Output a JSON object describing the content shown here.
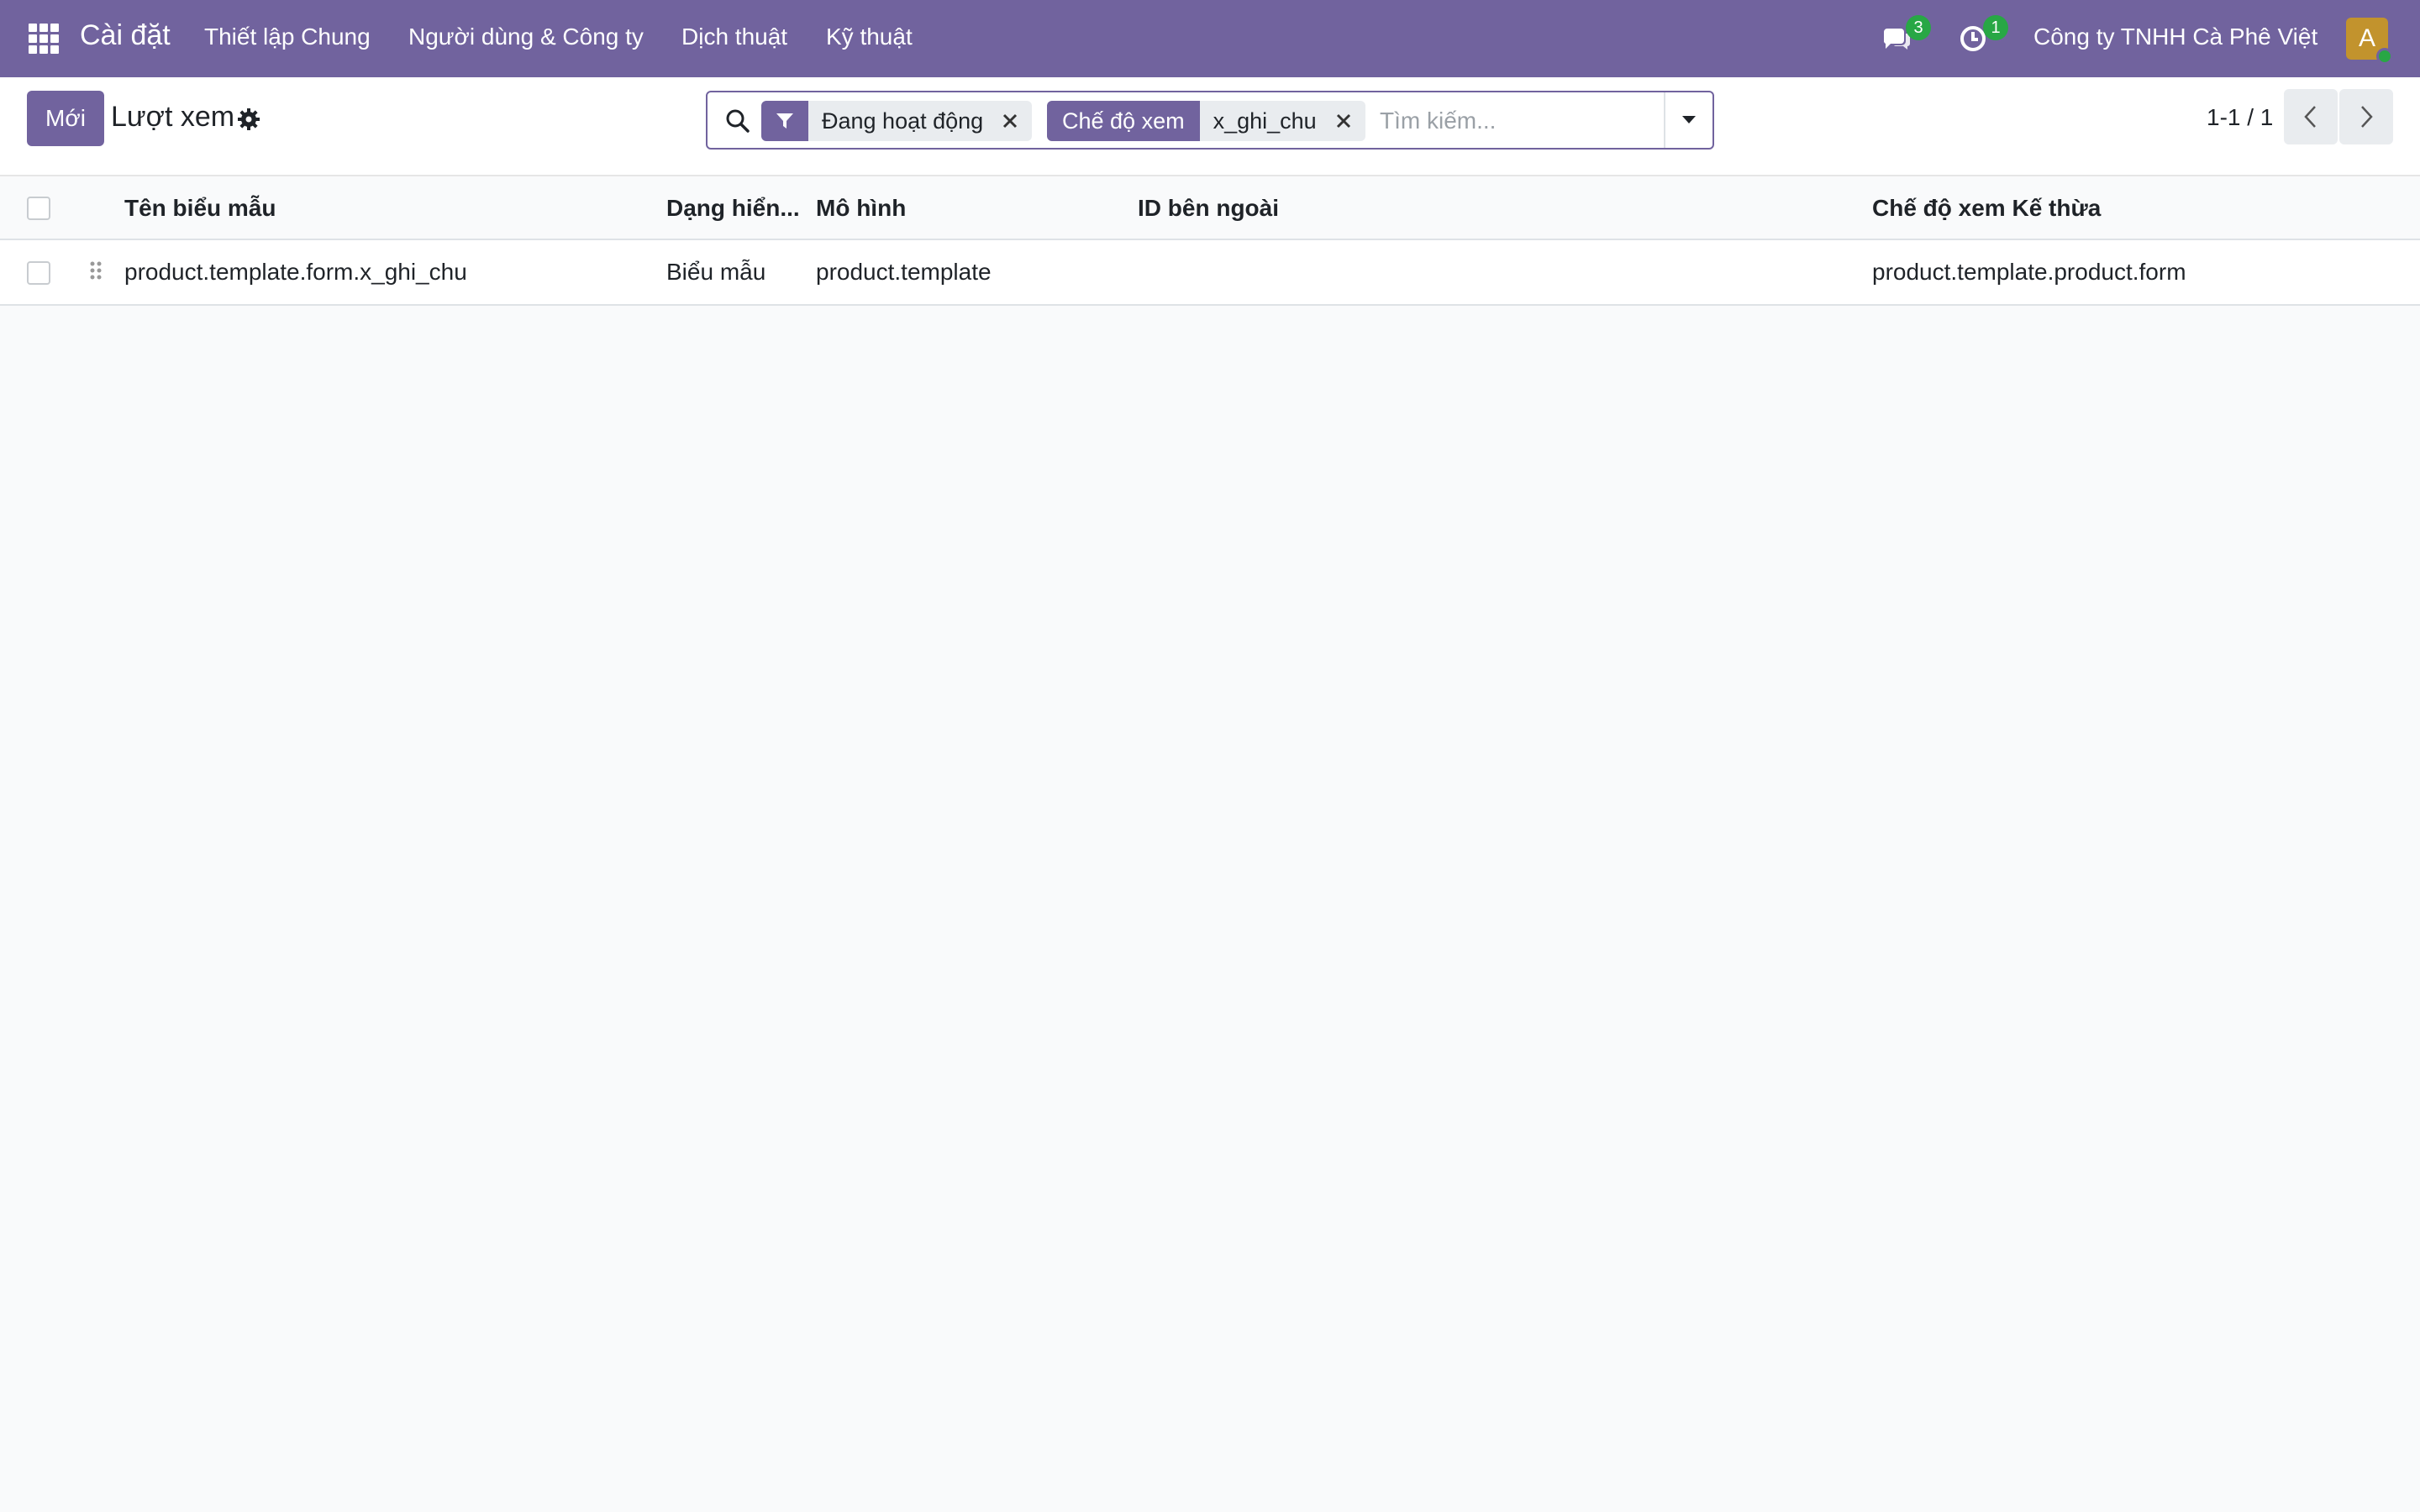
{
  "navbar": {
    "app_name": "Cài đặt",
    "menu": [
      {
        "label": "Thiết lập Chung"
      },
      {
        "label": "Người dùng & Công ty"
      },
      {
        "label": "Dịch thuật"
      },
      {
        "label": "Kỹ thuật"
      }
    ],
    "messages_count": "3",
    "activities_count": "1",
    "company": "Công ty TNHH Cà Phê Việt",
    "avatar_letter": "A",
    "icons": [
      "apps-grid-icon",
      "chat-icon",
      "clock-icon"
    ],
    "colors": {
      "primary": "#71639e",
      "badge": "#28a745",
      "avatar": "#c2932d"
    }
  },
  "control": {
    "new_label": "Mới",
    "title": "Lượt xem",
    "title_icon": "gear-icon",
    "search": {
      "facets": [
        {
          "label": "",
          "icon": "filter-icon",
          "value": "Đang hoạt động"
        },
        {
          "label": "Chế độ xem",
          "value": "x_ghi_chu"
        }
      ],
      "placeholder": "Tìm kiếm..."
    },
    "pager": "1-1 / 1"
  },
  "table": {
    "columns": [
      "Tên biểu mẫu",
      "Dạng hiển...",
      "Mô hình",
      "ID bên ngoài",
      "Chế độ xem Kế thừa"
    ],
    "rows": [
      {
        "name": "product.template.form.x_ghi_chu",
        "type": "Biểu mẫu",
        "model": "product.template",
        "external_id": "",
        "inherited_view": "product.template.product.form"
      }
    ]
  }
}
